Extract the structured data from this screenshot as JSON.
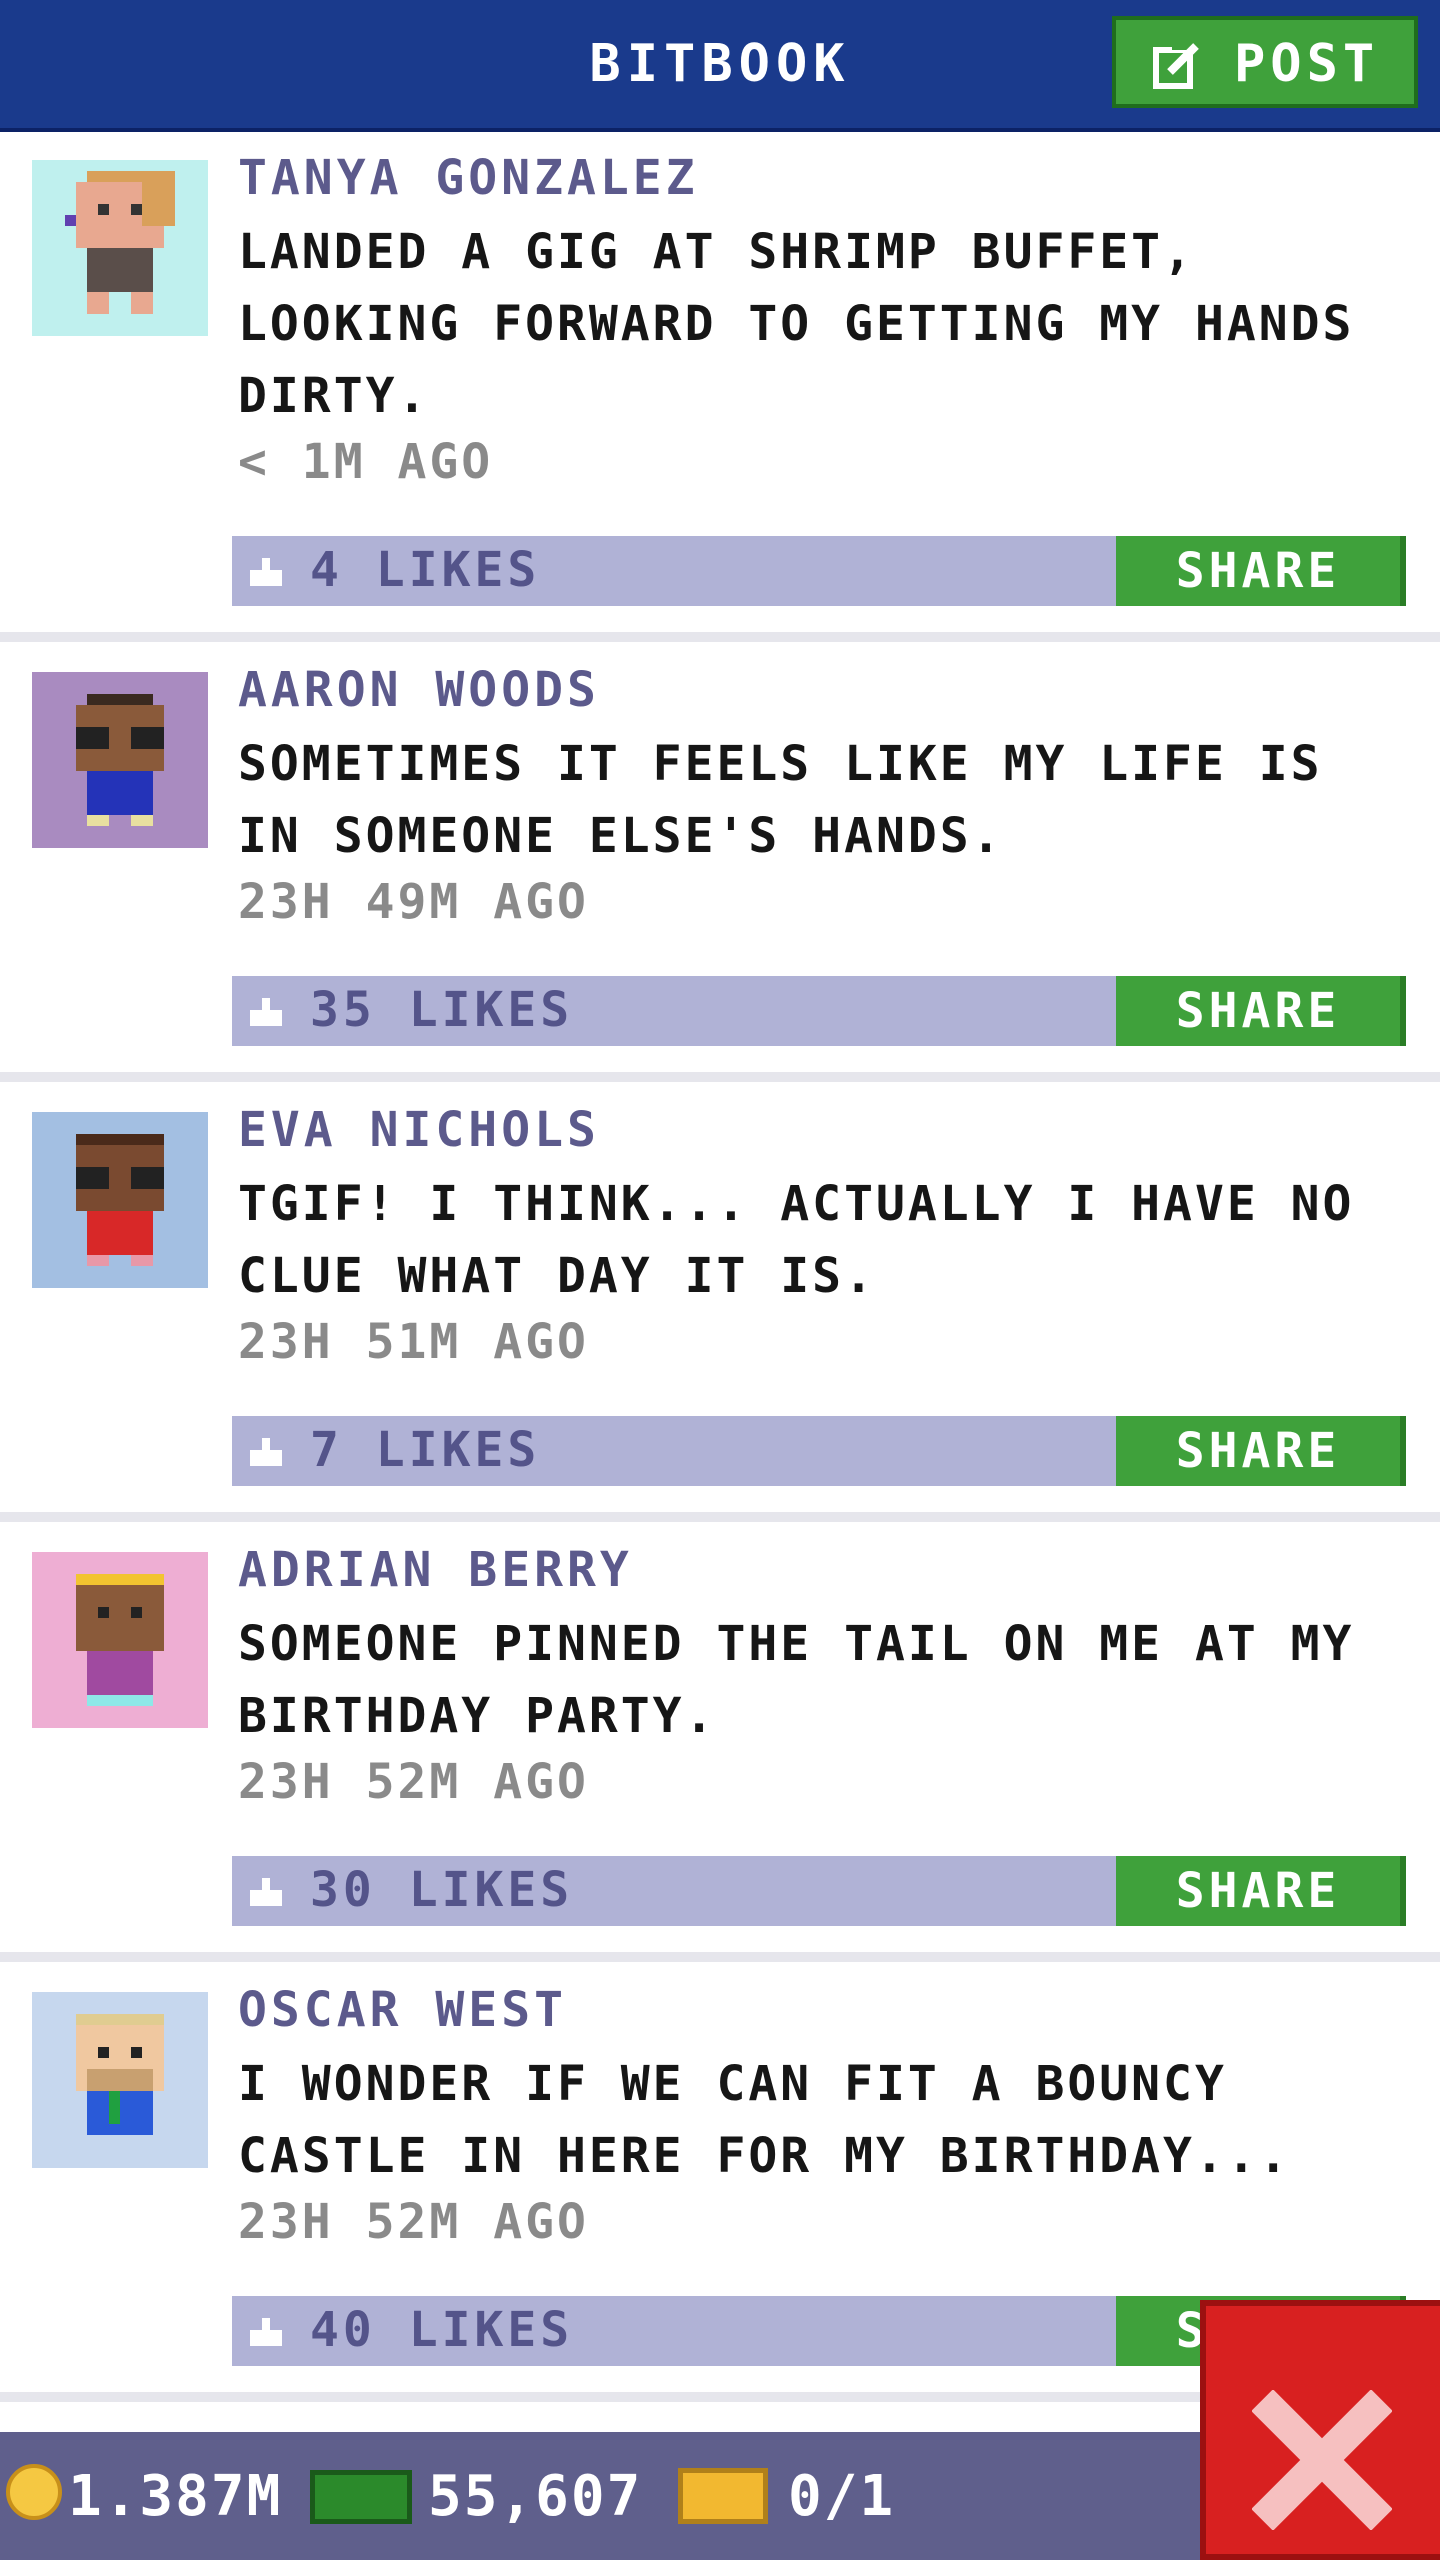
{
  "header": {
    "title": "BITBOOK",
    "post_label": "POST"
  },
  "posts": [
    {
      "name": "TANYA GONZALEZ",
      "text": "LANDED A GIG AT SHRIMP BUFFET, LOOKING FORWARD TO GETTING MY HANDS DIRTY.",
      "time": "< 1M AGO",
      "likes": "4 LIKES",
      "share": "SHARE",
      "avatar_bg": "#bff0ee"
    },
    {
      "name": "AARON WOODS",
      "text": "SOMETIMES IT FEELS LIKE MY LIFE IS IN SOMEONE ELSE'S HANDS.",
      "time": "23H 49M AGO",
      "likes": "35 LIKES",
      "share": "SHARE",
      "avatar_bg": "#a98bc0"
    },
    {
      "name": "EVA NICHOLS",
      "text": "TGIF! I THINK... ACTUALLY I HAVE NO CLUE WHAT DAY IT IS.",
      "time": "23H 51M AGO",
      "likes": "7 LIKES",
      "share": "SHARE",
      "avatar_bg": "#a3bfe2"
    },
    {
      "name": "ADRIAN BERRY",
      "text": "SOMEONE PINNED THE TAIL ON ME AT MY BIRTHDAY PARTY.",
      "time": "23H 52M AGO",
      "likes": "30 LIKES",
      "share": "SHARE",
      "avatar_bg": "#eeaed3"
    },
    {
      "name": "OSCAR WEST",
      "text": "I WONDER IF WE CAN FIT A BOUNCY CASTLE IN HERE FOR MY BIRTHDAY...",
      "time": "23H 52M AGO",
      "likes": "40 LIKES",
      "share": "SHARE",
      "avatar_bg": "#c6d7ee"
    }
  ],
  "footer": {
    "coins": "1.387M",
    "bux": "55,607",
    "tickets": "0/1"
  },
  "colors": {
    "header_bg": "#1a3a8c",
    "accent_green": "#3fa13b",
    "like_bar": "#b0b2d6",
    "close_red": "#d82020"
  },
  "icons": [
    "edit-icon",
    "thumbs-up-icon",
    "coin-icon",
    "cash-icon",
    "ticket-icon",
    "close-icon"
  ]
}
